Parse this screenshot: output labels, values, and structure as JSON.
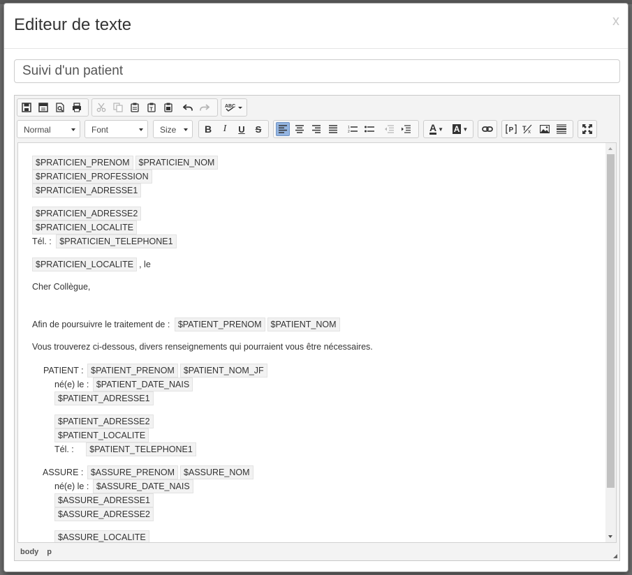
{
  "modal": {
    "title": "Editeur de texte",
    "close_label": "x"
  },
  "document_title": "Suivi d'un patient",
  "toolbar": {
    "format_select": "Normal",
    "font_select": "Font",
    "size_select": "Size",
    "buttons": {
      "save": "save-icon",
      "new_page": "new-page-icon",
      "preview": "preview-icon",
      "print": "print-icon",
      "cut": "cut-icon",
      "copy": "copy-icon",
      "paste": "paste-icon",
      "paste_text": "paste-text-icon",
      "paste_word": "paste-word-icon",
      "undo": "undo-icon",
      "redo": "redo-icon",
      "spellcheck": "spellcheck-icon",
      "bold": "B",
      "italic": "I",
      "underline": "U",
      "strike": "S",
      "align_left": "align-left-icon",
      "align_center": "align-center-icon",
      "align_right": "align-right-icon",
      "justify": "justify-icon",
      "numbered_list": "numbered-list-icon",
      "bullet_list": "bullet-list-icon",
      "outdent": "outdent-icon",
      "indent": "indent-icon",
      "text_color": "A",
      "bg_color": "A",
      "link": "link-icon",
      "placeholder": "placeholder-icon",
      "remove_format": "remove-format-icon",
      "image": "image-icon",
      "horizontal_rule": "horizontal-rule-icon",
      "maximize": "maximize-icon"
    },
    "spellcheck_label": "ABC"
  },
  "content": {
    "l1": [
      "$PRATICIEN_PRENOM",
      "$PRATICIEN_NOM"
    ],
    "l2": "$PRATICIEN_PROFESSION",
    "l3": "$PRATICIEN_ADRESSE1",
    "l4": "$PRATICIEN_ADRESSE2",
    "l5": "$PRATICIEN_LOCALITE",
    "l6_prefix": "Tél. :",
    "l6": "$PRATICIEN_TELEPHONE1",
    "l7": "$PRATICIEN_LOCALITE",
    "l7_suffix": ", le",
    "greeting": "Cher Collègue,",
    "intro_text": "Afin de poursuivre le traitement de :",
    "intro_ph": [
      "$PATIENT_PRENOM",
      "$PATIENT_NOM"
    ],
    "info_text": "Vous trouverez ci-dessous, divers renseignements qui pourraient vous être nécessaires.",
    "patient_label": "PATIENT :",
    "patient_ph": [
      "$PATIENT_PRENOM",
      "$PATIENT_NOM_JF"
    ],
    "born_label": "né(e) le :",
    "patient_dob": "$PATIENT_DATE_NAIS",
    "patient_addr1": "$PATIENT_ADRESSE1",
    "patient_addr2": "$PATIENT_ADRESSE2",
    "patient_loc": "$PATIENT_LOCALITE",
    "tel_label": "Tél. :",
    "patient_tel": "$PATIENT_TELEPHONE1",
    "assure_label": "ASSURE :",
    "assure_ph": [
      "$ASSURE_PRENOM",
      "$ASSURE_NOM"
    ],
    "assure_born_label": "né(e) le :",
    "assure_dob": "$ASSURE_DATE_NAIS",
    "assure_addr1": "$ASSURE_ADRESSE1",
    "assure_addr2": "$ASSURE_ADRESSE2",
    "assure_loc": "$ASSURE_LOCALITE"
  },
  "statusbar": [
    "body",
    "p"
  ]
}
